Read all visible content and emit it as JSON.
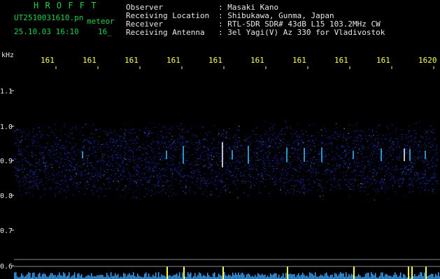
{
  "header": {
    "brand": "H R O F F T",
    "filename": "UT2510031610.pn",
    "tag": "meteor",
    "datetime": "25.10.03 16:10",
    "minute": "16_",
    "labels": {
      "observer": "Observer",
      "location": "Receiving Location",
      "receiver": "Receiver",
      "antenna": "Receiving Antenna"
    },
    "values": {
      "observer": ": Masaki Kano",
      "location": ": Shibukawa, Gunma, Japan",
      "receiver": ": RTL-SDR SDR# 43dB L15 103.2MHz CW",
      "antenna": ": 3el Yagi(V) Az 330 for Vladivostok"
    }
  },
  "axis": {
    "unit": "kHz",
    "y_ticks": [
      "1.1",
      "1.0",
      "0.9",
      "0.8",
      "0.7",
      "0.6"
    ],
    "x_ticks": [
      "161",
      "161",
      "161",
      "161",
      "161",
      "161",
      "161",
      "161",
      "161",
      "1620"
    ]
  },
  "colors": {
    "background": "#000000",
    "header_green": "#23d14a",
    "header_white": "#e8e8e8",
    "tick_yellow": "#ffff55",
    "noise_blue": "#2a3cff",
    "signal_cyan": "#39c6ff",
    "signal_white": "#ffffff"
  }
}
